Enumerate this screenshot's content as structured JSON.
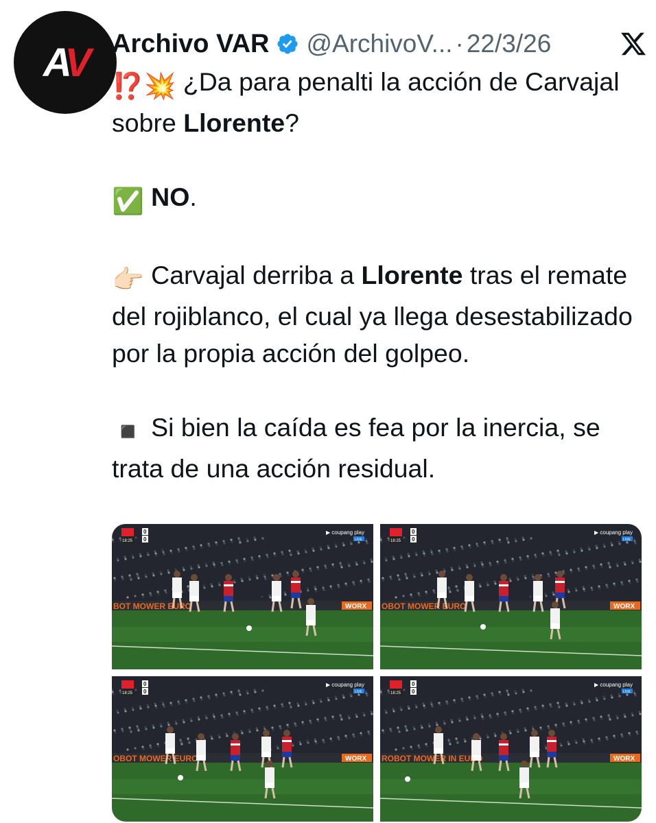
{
  "account": {
    "avatar_text": "AV",
    "name": "Archivo VAR",
    "handle": "@ArchivoV...",
    "separator": "·",
    "date": "22/3/26"
  },
  "tweet": {
    "line1_emoji": "⁉️💥",
    "line1_text": " ¿Da para penalti la acción de Carvajal sobre ",
    "line1_bold": "Llorente",
    "line1_end": "?",
    "line2_emoji": "✅",
    "line2_bold": "NO",
    "line2_end": ".",
    "line3_emoji": "👉🏻",
    "line3_text": " Carvajal derriba a ",
    "line3_bold": "Llorente",
    "line3_end": " tras el remate del rojiblanco, el cual ya llega desestabilizado por la propia acción del golpeo.",
    "line4_emoji": "◾️",
    "line4_text": " Si bien la caída es fea por la inercia, se trata de una acción residual."
  },
  "media": {
    "frames": [
      {
        "score_time": "18:25",
        "score_home": "0",
        "score_away": "0",
        "broadcaster": "coupang play",
        "live": "LIVE",
        "board": "BOT MOWER EURO",
        "board2": "WORX"
      },
      {
        "score_time": "18:25",
        "score_home": "0",
        "score_away": "0",
        "broadcaster": "coupang play",
        "live": "LIVE",
        "board": "OBOT MOWER EURO",
        "board2": "WORX"
      },
      {
        "score_time": "18:25",
        "score_home": "0",
        "score_away": "0",
        "broadcaster": "coupang play",
        "live": "LIVE",
        "board": "OBOT MOWER EURO",
        "board2": "WORX"
      },
      {
        "score_time": "18:25",
        "score_home": "0",
        "score_away": "0",
        "broadcaster": "coupang play",
        "live": "LIVE",
        "board": "ROBOT MOWER IN EURO",
        "board2": "WORX"
      }
    ]
  },
  "colors": {
    "verified": "#1d9bf0",
    "secondary_text": "#536471",
    "pitch": "#2f6a2a",
    "crowd": "#2a2d3a"
  }
}
